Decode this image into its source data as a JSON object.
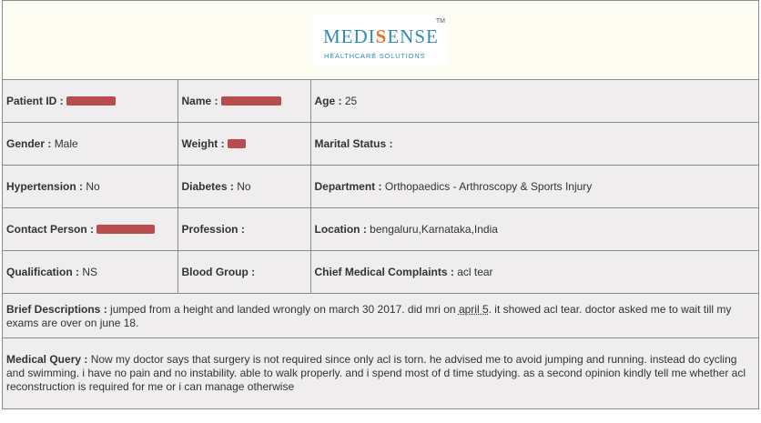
{
  "logo": {
    "part1": "MEDI",
    "part2": "S",
    "part3": "ENSE",
    "tm": "TM",
    "tagline": "HEALTHCARE SOLUTIONS"
  },
  "rows": [
    [
      {
        "label": "Patient ID :",
        "value": ""
      },
      {
        "label": "Name :",
        "value": ""
      },
      {
        "label": "Age :",
        "value": "25"
      }
    ],
    [
      {
        "label": "Gender :",
        "value": "Male"
      },
      {
        "label": "Weight :",
        "value": ""
      },
      {
        "label": "Marital Status :",
        "value": ""
      }
    ],
    [
      {
        "label": "Hypertension :",
        "value": "No"
      },
      {
        "label": "Diabetes :",
        "value": "No"
      },
      {
        "label": "Department :",
        "value": "Orthopaedics - Arthroscopy & Sports Injury"
      }
    ],
    [
      {
        "label": "Contact Person :",
        "value": ""
      },
      {
        "label": "Profession :",
        "value": ""
      },
      {
        "label": "Location :",
        "value": "bengaluru,Karnataka,India"
      }
    ],
    [
      {
        "label": "Qualification :",
        "value": "NS"
      },
      {
        "label": "Blood Group :",
        "value": ""
      },
      {
        "label": "Chief Medical Complaints :",
        "value": "acl tear"
      }
    ]
  ],
  "brief": {
    "label": "Brief Descriptions :",
    "text_a": "jumped from a height and landed wrongly on march 30 2017. did mri on ",
    "text_link": "april 5",
    "text_b": ". it showed acl tear. doctor asked me to wait till my exams are over on june 18."
  },
  "query": {
    "label": "Medical Query :",
    "text": "Now my doctor says that surgery is not required since only acl is torn. he advised me to avoid jumping and running. instead do cycling and swimming. i have no pain and no instability. able to walk properly. and i spend most of d time studying. as a second opinion kindly tell me whether acl reconstruction is required for me or i can manage otherwise"
  },
  "colors": {
    "redaction": "#b33a3a",
    "logo_blue": "#2e8ab8",
    "logo_orange": "#e8742c"
  }
}
